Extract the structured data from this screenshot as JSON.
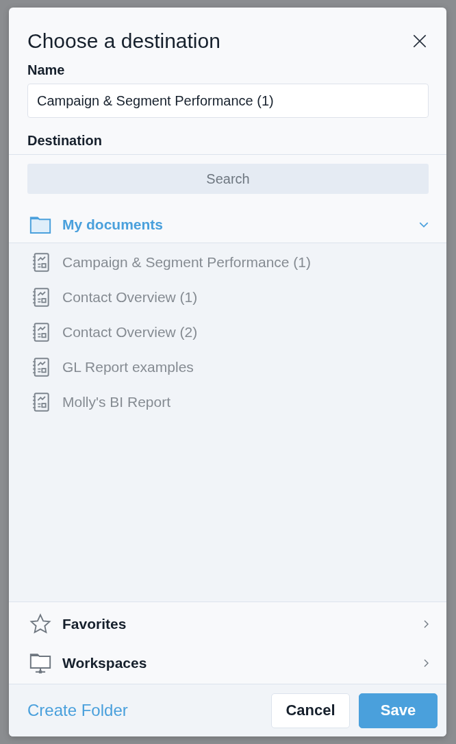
{
  "dialog": {
    "title": "Choose a destination",
    "name_label": "Name",
    "name_value": "Campaign & Segment Performance (1)",
    "destination_label": "Destination",
    "search": {
      "placeholder": "Search"
    },
    "folder": {
      "label": "My documents",
      "expanded": true,
      "children": [
        {
          "label": "Campaign & Segment Performance (1)",
          "selected": false
        },
        {
          "label": "Contact Overview (1)",
          "selected": false
        },
        {
          "label": "Contact Overview (2)",
          "selected": false
        },
        {
          "label": "GL Report examples",
          "selected": false
        },
        {
          "label": "Molly's BI Report",
          "selected": false
        }
      ]
    },
    "sections": [
      {
        "label": "Favorites",
        "kind": "star"
      },
      {
        "label": "Workspaces",
        "kind": "network-folder"
      }
    ],
    "footer": {
      "link": "Create Folder",
      "buttons": [
        {
          "label": "Cancel",
          "kind": "secondary"
        },
        {
          "label": "Save",
          "kind": "primary"
        }
      ]
    }
  }
}
